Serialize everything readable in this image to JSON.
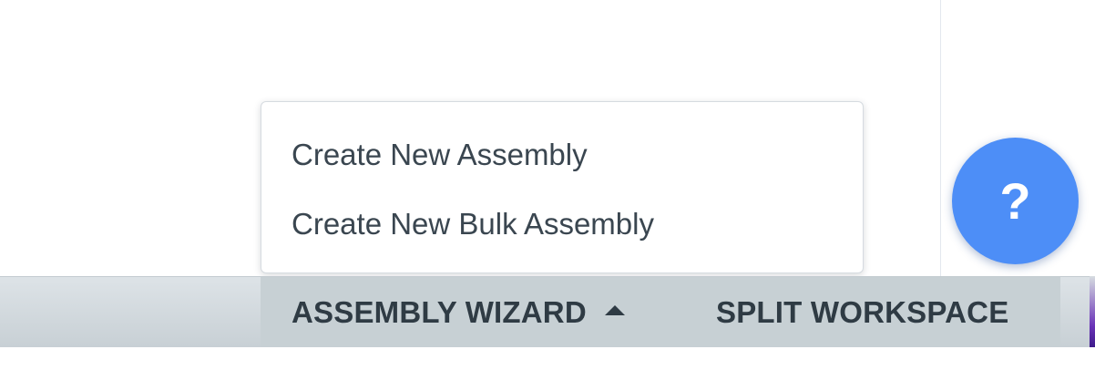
{
  "dropdown": {
    "items": [
      {
        "label": "Create New Assembly"
      },
      {
        "label": "Create New Bulk Assembly"
      }
    ]
  },
  "toolbar": {
    "assembly_wizard_label": "ASSEMBLY WIZARD",
    "split_workspace_label": "SPLIT WORKSPACE"
  },
  "help_button": {
    "glyph": "?"
  },
  "colors": {
    "help_button": "#4d8ef7",
    "toolbar_bg": "#c7d0d4",
    "toolbar_text": "#2f3b44",
    "menu_text": "#3a4650"
  }
}
